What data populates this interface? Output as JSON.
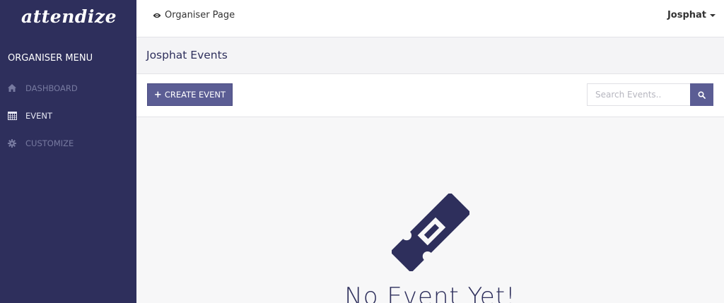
{
  "brand": {
    "logo_text": "attendize"
  },
  "sidebar": {
    "title": "ORGANISER MENU",
    "items": [
      {
        "label": "DASHBOARD",
        "icon": "home-icon"
      },
      {
        "label": "EVENT",
        "icon": "calendar-icon"
      },
      {
        "label": "CUSTOMIZE",
        "icon": "gear-icon"
      }
    ]
  },
  "topbar": {
    "organiser_page": "Organiser Page",
    "user_name": "Josphat"
  },
  "page": {
    "title": "Josphat Events"
  },
  "toolbar": {
    "create_label": "CREATE EVENT",
    "search_placeholder": "Search Events.."
  },
  "empty_state": {
    "text": "No Event Yet!",
    "icon": "ticket-icon"
  },
  "colors": {
    "sidebar_bg": "#2e2f5c",
    "accent": "#5b5d94"
  }
}
